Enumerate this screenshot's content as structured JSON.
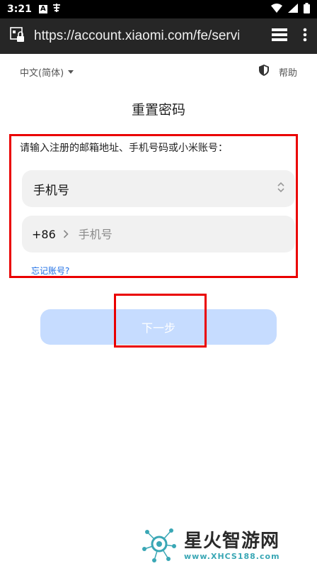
{
  "status_bar": {
    "time": "3:21",
    "a_icon": "A",
    "signal": "⊕"
  },
  "browser": {
    "url": "https://account.xiaomi.com/fe/service"
  },
  "header": {
    "language": "中文(简体)",
    "help": "帮助"
  },
  "page": {
    "title": "重置密码"
  },
  "form": {
    "instruction": "请输入注册的邮箱地址、手机号码或小米账号：",
    "account_type": "手机号",
    "country_code": "+86",
    "phone_placeholder": "手机号",
    "forgot_link": "忘记账号?",
    "next_label": "下一步"
  },
  "watermark": {
    "title": "星火智游网",
    "url": "www.XHCS188.com"
  },
  "colors": {
    "link": "#1f6fe5",
    "button_disabled": "#c6dcff",
    "highlight_frame": "#ea0000",
    "url_bar": "#262626"
  }
}
